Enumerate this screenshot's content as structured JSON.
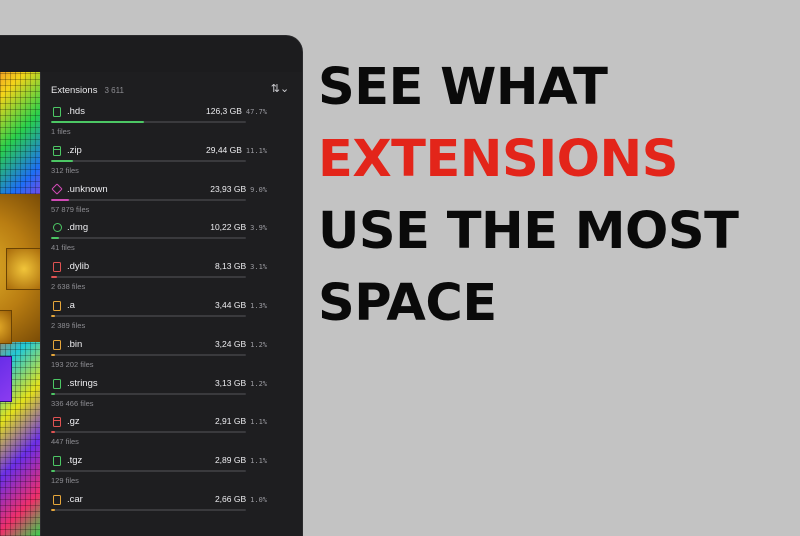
{
  "colors": {
    "background": "#c3c3c3",
    "accent": "#e3251a",
    "panel": "#1e1e20"
  },
  "headline": {
    "line1": "SEE WHAT",
    "line2": "EXTENSIONS",
    "line3": "USE THE MOST",
    "line4": "SPACE"
  },
  "sidebar": {
    "title": "Extensions",
    "count": "3 611",
    "sort_icon": "sort-arrows-icon",
    "items": [
      {
        "name": ".hds",
        "size": "126,3 GB",
        "percent": "47.7%",
        "files": "1 files",
        "fraction": 0.477,
        "color": "#4cc764",
        "icon": "document-icon"
      },
      {
        "name": ".zip",
        "size": "29,44 GB",
        "percent": "11.1%",
        "files": "312 files",
        "fraction": 0.111,
        "color": "#4cc764",
        "icon": "archive-icon"
      },
      {
        "name": ".unknown",
        "size": "23,93 GB",
        "percent": "9.0%",
        "files": "57 879 files",
        "fraction": 0.09,
        "color": "#d04bb5",
        "icon": "diamond-icon"
      },
      {
        "name": ".dmg",
        "size": "10,22 GB",
        "percent": "3.9%",
        "files": "41 files",
        "fraction": 0.039,
        "color": "#4cc764",
        "icon": "disk-image-icon"
      },
      {
        "name": ".dylib",
        "size": "8,13 GB",
        "percent": "3.1%",
        "files": "2 638 files",
        "fraction": 0.031,
        "color": "#e05252",
        "icon": "document-icon"
      },
      {
        "name": ".a",
        "size": "3,44 GB",
        "percent": "1.3%",
        "files": "2 389 files",
        "fraction": 0.013,
        "color": "#e6a63a",
        "icon": "document-icon"
      },
      {
        "name": ".bin",
        "size": "3,24 GB",
        "percent": "1.2%",
        "files": "193 202 files",
        "fraction": 0.012,
        "color": "#e6a63a",
        "icon": "document-icon"
      },
      {
        "name": ".strings",
        "size": "3,13 GB",
        "percent": "1.2%",
        "files": "336 466 files",
        "fraction": 0.012,
        "color": "#4cc764",
        "icon": "document-icon"
      },
      {
        "name": ".gz",
        "size": "2,91 GB",
        "percent": "1.1%",
        "files": "447 files",
        "fraction": 0.011,
        "color": "#e05252",
        "icon": "archive-icon"
      },
      {
        "name": ".tgz",
        "size": "2,89 GB",
        "percent": "1.1%",
        "files": "129 files",
        "fraction": 0.011,
        "color": "#4cc764",
        "icon": "document-icon"
      },
      {
        "name": ".car",
        "size": "2,66 GB",
        "percent": "1.0%",
        "files": "",
        "fraction": 0.01,
        "color": "#e6a63a",
        "icon": "document-icon"
      }
    ]
  }
}
